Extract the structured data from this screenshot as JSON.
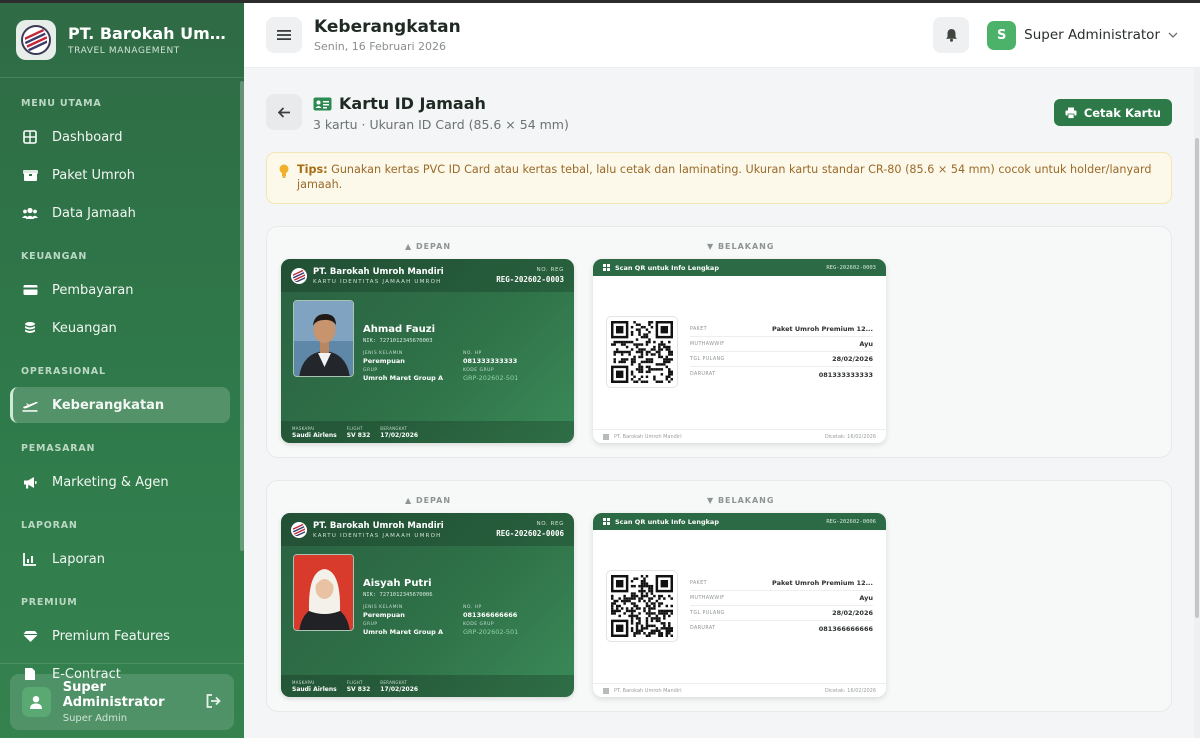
{
  "brand": {
    "name": "PT. Barokah Umroh Mandiri",
    "sub": "TRAVEL MANAGEMENT"
  },
  "sidebar": {
    "sections": [
      {
        "title": "MENU UTAMA",
        "items": [
          {
            "label": "Dashboard",
            "icon": "grid-icon"
          },
          {
            "label": "Paket Umroh",
            "icon": "box-icon"
          },
          {
            "label": "Data Jamaah",
            "icon": "users-icon"
          }
        ]
      },
      {
        "title": "KEUANGAN",
        "items": [
          {
            "label": "Pembayaran",
            "icon": "credit-card-icon"
          },
          {
            "label": "Keuangan",
            "icon": "coins-icon"
          }
        ]
      },
      {
        "title": "OPERASIONAL",
        "items": [
          {
            "label": "Keberangkatan",
            "icon": "plane-departure-icon",
            "active": true
          }
        ]
      },
      {
        "title": "PEMASARAN",
        "items": [
          {
            "label": "Marketing & Agen",
            "icon": "megaphone-icon"
          }
        ]
      },
      {
        "title": "LAPORAN",
        "items": [
          {
            "label": "Laporan",
            "icon": "chart-icon"
          }
        ]
      },
      {
        "title": "PREMIUM",
        "items": [
          {
            "label": "Premium Features",
            "icon": "gem-icon"
          },
          {
            "label": "E-Contract",
            "icon": "file-icon"
          }
        ]
      }
    ],
    "user": {
      "name": "Super Administrator",
      "role": "Super Admin"
    }
  },
  "header": {
    "title": "Keberangkatan",
    "date": "Senin, 16 Februari 2026",
    "user_initial": "S",
    "user_name": "Super Administrator"
  },
  "page": {
    "title": "Kartu ID Jamaah",
    "subtitle": "3 kartu · Ukuran ID Card (85.6 × 54 mm)",
    "print_label": "Cetak Kartu",
    "tips_label": "Tips:",
    "tips_text": "Gunakan kertas PVC ID Card atau kertas tebal, lalu cetak dan laminating. Ukuran kartu standar CR-80 (85.6 × 54 mm) cocok untuk holder/lanyard jamaah.",
    "front_label": "▲ DEPAN",
    "back_label": "▼ BELAKANG"
  },
  "card_labels": {
    "org": "PT. Barokah Umroh Mandiri",
    "org_sub": "KARTU IDENTITAS JAMAAH UMROH",
    "no_reg": "NO. REG",
    "gender": "JENIS KELAMIN",
    "phone": "NO. HP",
    "group": "GRUP",
    "group_code": "KODE GRUP",
    "airline": "MASKAPAI",
    "flight": "FLIGHT",
    "depart": "BERANGKAT",
    "qr_title": "Scan QR untuk Info Lengkap",
    "paket": "PAKET",
    "muthawwif": "MUTHAWWIF",
    "return": "TGL PULANG",
    "emergency": "DARURAT",
    "footer_org": "PT. Barokah Umroh Mandiri",
    "printed_prefix": "Dicetak: "
  },
  "cards": [
    {
      "reg": "REG-202602-0003",
      "name": "Ahmad Fauzi",
      "nik": "NIK: 7271012345670003",
      "gender": "Perempuan",
      "phone": "081333333333",
      "group": "Umroh Maret Group A",
      "group_code": "GRP-202602-501",
      "airline": "Saudi Airlens",
      "flight": "SV 832",
      "depart": "17/02/2026",
      "paket": "Paket Umroh Premium 12...",
      "muthawwif": "Ayu",
      "return": "28/02/2026",
      "emergency": "081333333333",
      "printed": "Dicetak: 16/02/2026",
      "photo": "man-portrait"
    },
    {
      "reg": "REG-202602-0006",
      "name": "Aisyah Putri",
      "nik": "NIK: 7271012345670006",
      "gender": "Perempuan",
      "phone": "081366666666",
      "group": "Umroh Maret Group A",
      "group_code": "GRP-202602-501",
      "airline": "Saudi Airlens",
      "flight": "SV 832",
      "depart": "17/02/2026",
      "paket": "Paket Umroh Premium 12...",
      "muthawwif": "Ayu",
      "return": "28/02/2026",
      "emergency": "081366666666",
      "printed": "Dicetak: 16/02/2026",
      "photo": "woman-hijab-portrait"
    }
  ],
  "colors": {
    "primary": "#2d7a48",
    "sidebar": "#2f7148",
    "tips_bg": "#fdf9ea",
    "tips_text": "#9a6a2a"
  }
}
